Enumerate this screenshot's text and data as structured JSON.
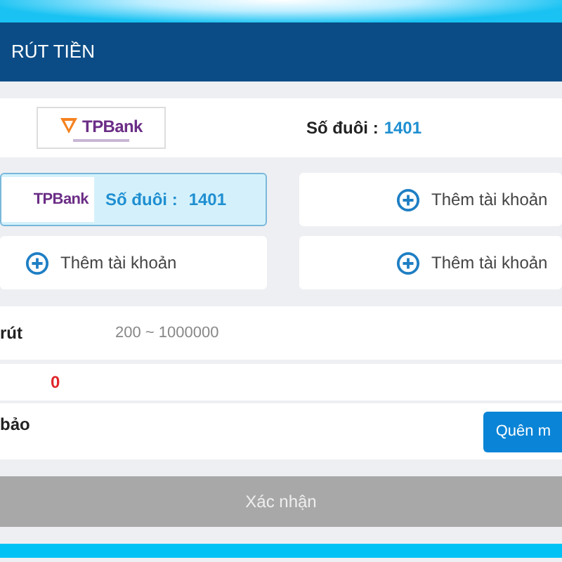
{
  "header": {
    "title": "RÚT TIỀN"
  },
  "bank_summary": {
    "logo": "TPBank",
    "label": "Số đuôi :",
    "number": "1401"
  },
  "accounts": [
    {
      "kind": "bank",
      "logo": "TPBank",
      "label": "Số đuôi :",
      "number": "1401",
      "selected": true
    },
    {
      "kind": "add",
      "label": "Thêm tài khoản",
      "selected": false
    },
    {
      "kind": "add",
      "label": "Thêm tài khoản",
      "selected": false
    },
    {
      "kind": "add",
      "label": "Thêm tài khoản",
      "selected": false
    }
  ],
  "form": {
    "amount_label": "rút",
    "amount_placeholder": "200 ~ 1000000",
    "balance": "0",
    "password_label": "bảo",
    "forgot_button": "Quên m"
  },
  "confirm_button": "Xác nhận"
}
